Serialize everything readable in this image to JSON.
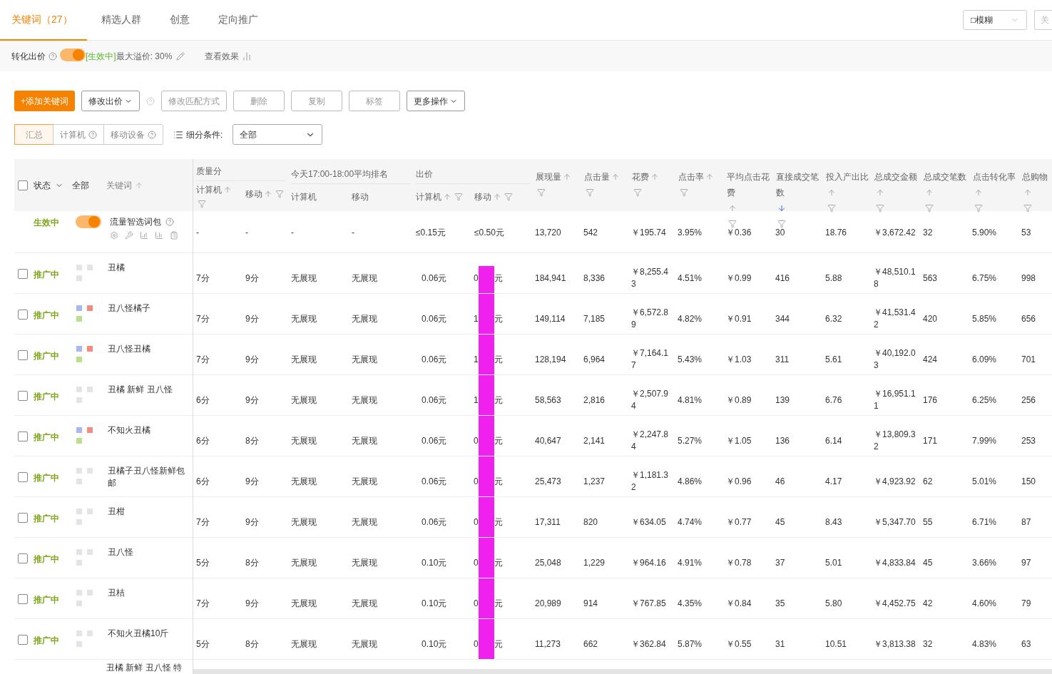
{
  "tabs": [
    {
      "label": "关键词（27）",
      "selected": true
    },
    {
      "label": "精选人群",
      "selected": false
    },
    {
      "label": "创意",
      "selected": false
    },
    {
      "label": "定向推广",
      "selected": false
    }
  ],
  "match_select": {
    "value": "□模糊"
  },
  "keyword_search": {
    "placeholder": "关"
  },
  "conversion_bid": {
    "label": "转化出价",
    "on": true,
    "status": "[生效中]",
    "max_premium": "最大溢价: 30%",
    "view_effect": "查看效果"
  },
  "toolbar": [
    {
      "label": "+添加关键词",
      "kind": "primary",
      "disabled": false,
      "caret": false
    },
    {
      "label": "修改出价",
      "kind": "normal",
      "disabled": false,
      "caret": true
    },
    {
      "kind": "help"
    },
    {
      "label": "修改匹配方式",
      "kind": "normal",
      "disabled": true,
      "caret": false
    },
    {
      "label": "删除",
      "kind": "normal",
      "disabled": true,
      "caret": false
    },
    {
      "label": "复制",
      "kind": "normal",
      "disabled": true,
      "caret": false
    },
    {
      "label": "标签",
      "kind": "normal",
      "disabled": true,
      "caret": false
    },
    {
      "label": "更多操作",
      "kind": "normal",
      "disabled": false,
      "caret": true
    }
  ],
  "device_tabs": [
    {
      "label": "汇总",
      "selected": true,
      "help": false
    },
    {
      "label": "计算机",
      "selected": false,
      "help": true
    },
    {
      "label": "移动设备",
      "selected": false,
      "help": true
    }
  ],
  "breakdown": {
    "label": "细分条件:",
    "value": "全部"
  },
  "left_header": {
    "checked": false,
    "status": "状态",
    "filter": "全部",
    "keyword": "关键词"
  },
  "column_groups": [
    {
      "label": "质量分",
      "columns": [
        {
          "label": "计算机",
          "sortable": true,
          "sorted": false,
          "filterable": true
        },
        {
          "label": "移动",
          "sortable": true,
          "sorted": false,
          "filterable": true
        }
      ]
    },
    {
      "label": "今天17:00-18:00平均排名",
      "columns": [
        {
          "label": "计算机",
          "sortable": false,
          "filterable": false
        },
        {
          "label": "移动",
          "sortable": false,
          "filterable": false
        }
      ]
    },
    {
      "label": "出价",
      "columns": [
        {
          "label": "计算机",
          "sortable": true,
          "sorted": false,
          "filterable": true
        },
        {
          "label": "移动",
          "sortable": true,
          "sorted": false,
          "filterable": true
        }
      ]
    }
  ],
  "columns": [
    {
      "label": "展现量",
      "sortable": true,
      "sorted": false,
      "filterable": true
    },
    {
      "label": "点击量",
      "sortable": true,
      "sorted": false,
      "filterable": true
    },
    {
      "label": "花费",
      "sortable": true,
      "sorted": false,
      "filterable": true
    },
    {
      "label": "点击率",
      "sortable": true,
      "sorted": false,
      "filterable": true
    },
    {
      "label": "平均点击花费",
      "sortable": true,
      "sorted": false,
      "filterable": true
    },
    {
      "label": "直接成交笔数",
      "sortable": true,
      "sorted": true,
      "filterable": true
    },
    {
      "label": "投入产出比",
      "sortable": true,
      "sorted": false,
      "filterable": true
    },
    {
      "label": "总成交金额",
      "sortable": true,
      "sorted": false,
      "filterable": true
    },
    {
      "label": "总成交笔数",
      "sortable": true,
      "sorted": false,
      "filterable": true
    },
    {
      "label": "点击转化率",
      "sortable": true,
      "sorted": false,
      "filterable": true
    },
    {
      "label": "总购物",
      "sortable": true,
      "sorted": false,
      "filterable": true
    }
  ],
  "package_row": {
    "status": "生效中",
    "on": true,
    "name": "流量智选词包",
    "cells": [
      "-",
      "-",
      "-",
      "-",
      "≤0.15元",
      "≤0.50元",
      "13,720",
      "542",
      "￥195.74",
      "3.95%",
      "￥0.36",
      "30",
      "18.76",
      "￥3,672.42",
      "32",
      "5.90%",
      "53"
    ]
  },
  "rows": [
    {
      "checked": false,
      "status": "推广中",
      "tagged": false,
      "keyword": "丑橘",
      "cells": [
        "7分",
        "9分",
        "无展现",
        "无展现",
        "0.06元"
      ],
      "mobile_bid": {
        "start": "0",
        "end": "元",
        "redacted": true
      },
      "metrics": [
        "184,941",
        "8,336",
        "￥8,255.43",
        "4.51%",
        "￥0.99",
        "416",
        "5.88",
        "￥48,510.18",
        "563",
        "6.75%",
        "998"
      ]
    },
    {
      "checked": false,
      "status": "推广中",
      "tagged": true,
      "keyword": "丑八怪橘子",
      "cells": [
        "7分",
        "9分",
        "无展现",
        "无展现",
        "0.06元"
      ],
      "mobile_bid": {
        "start": "1",
        "end": "元",
        "redacted": true
      },
      "metrics": [
        "149,114",
        "7,185",
        "￥6,572.89",
        "4.82%",
        "￥0.91",
        "344",
        "6.32",
        "￥41,531.42",
        "420",
        "5.85%",
        "656"
      ]
    },
    {
      "checked": false,
      "status": "推广中",
      "tagged": true,
      "keyword": "丑八怪丑橘",
      "cells": [
        "7分",
        "9分",
        "无展现",
        "无展现",
        "0.06元"
      ],
      "mobile_bid": {
        "start": "1",
        "end": "元",
        "redacted": true
      },
      "metrics": [
        "128,194",
        "6,964",
        "￥7,164.17",
        "5.43%",
        "￥1.03",
        "311",
        "5.61",
        "￥40,192.03",
        "424",
        "6.09%",
        "701"
      ]
    },
    {
      "checked": false,
      "status": "推广中",
      "tagged": false,
      "keyword": "丑橘 新鲜 丑八怪",
      "cells": [
        "6分",
        "9分",
        "无展现",
        "无展现",
        "0.06元"
      ],
      "mobile_bid": {
        "start": "1",
        "end": "元",
        "redacted": true
      },
      "metrics": [
        "58,563",
        "2,816",
        "￥2,507.94",
        "4.81%",
        "￥0.89",
        "139",
        "6.76",
        "￥16,951.11",
        "176",
        "6.25%",
        "256"
      ]
    },
    {
      "checked": false,
      "status": "推广中",
      "tagged": true,
      "keyword": "不知火丑橘",
      "cells": [
        "6分",
        "8分",
        "无展现",
        "无展现",
        "0.06元"
      ],
      "mobile_bid": {
        "start": "0",
        "end": "元",
        "redacted": true
      },
      "metrics": [
        "40,647",
        "2,141",
        "￥2,247.84",
        "5.27%",
        "￥1.05",
        "136",
        "6.14",
        "￥13,809.32",
        "171",
        "7.99%",
        "253"
      ]
    },
    {
      "checked": false,
      "status": "推广中",
      "tagged": false,
      "keyword": "丑橘子丑八怪新鲜包邮",
      "cells": [
        "6分",
        "9分",
        "无展现",
        "无展现",
        "0.06元"
      ],
      "mobile_bid": {
        "start": "0",
        "end": "元",
        "redacted": true
      },
      "metrics": [
        "25,473",
        "1,237",
        "￥1,181.32",
        "4.86%",
        "￥0.96",
        "46",
        "4.17",
        "￥4,923.92",
        "62",
        "5.01%",
        "150"
      ]
    },
    {
      "checked": false,
      "status": "推广中",
      "tagged": false,
      "keyword": "丑柑",
      "cells": [
        "7分",
        "9分",
        "无展现",
        "无展现",
        "0.06元"
      ],
      "mobile_bid": {
        "start": "0",
        "end": "元",
        "redacted": true
      },
      "metrics": [
        "17,311",
        "820",
        "￥634.05",
        "4.74%",
        "￥0.77",
        "45",
        "8.43",
        "￥5,347.70",
        "55",
        "6.71%",
        "87"
      ]
    },
    {
      "checked": false,
      "status": "推广中",
      "tagged": false,
      "keyword": "丑八怪",
      "cells": [
        "5分",
        "8分",
        "无展现",
        "无展现",
        "0.10元"
      ],
      "mobile_bid": {
        "start": "0",
        "end": "元",
        "redacted": true
      },
      "metrics": [
        "25,048",
        "1,229",
        "￥964.16",
        "4.91%",
        "￥0.78",
        "37",
        "5.01",
        "￥4,833.84",
        "45",
        "3.66%",
        "97"
      ]
    },
    {
      "checked": false,
      "status": "推广中",
      "tagged": false,
      "keyword": "丑桔",
      "cells": [
        "7分",
        "9分",
        "无展现",
        "无展现",
        "0.10元"
      ],
      "mobile_bid": {
        "start": "0",
        "end": "元",
        "redacted": true
      },
      "metrics": [
        "20,989",
        "914",
        "￥767.85",
        "4.35%",
        "￥0.84",
        "35",
        "5.80",
        "￥4,452.75",
        "42",
        "4.60%",
        "79"
      ]
    },
    {
      "checked": false,
      "status": "推广中",
      "tagged": false,
      "keyword": "不知火丑橘10斤",
      "cells": [
        "5分",
        "8分",
        "无展现",
        "无展现",
        "0.10元"
      ],
      "mobile_bid": {
        "start": "0",
        "end": "元",
        "redacted": true
      },
      "metrics": [
        "11,273",
        "662",
        "￥362.84",
        "5.87%",
        "￥0.55",
        "31",
        "10.51",
        "￥3,813.38",
        "32",
        "4.83%",
        "63"
      ]
    }
  ],
  "partial_row": {
    "keyword": "丑橘 新鲜 丑八怪 特"
  }
}
